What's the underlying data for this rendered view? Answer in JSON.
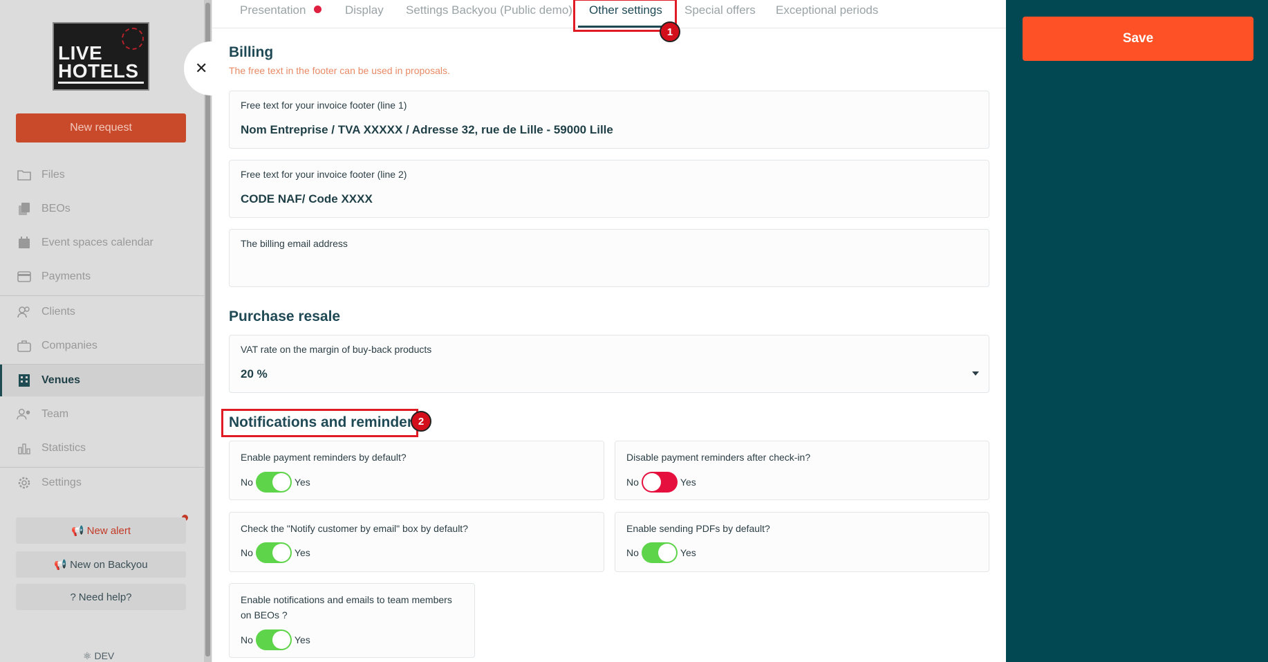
{
  "sidebar": {
    "logo_text": "LIVE HOTELS",
    "new_request": "New request",
    "items": [
      {
        "label": "Files",
        "icon": "folder-icon"
      },
      {
        "label": "BEOs",
        "icon": "copy-icon"
      },
      {
        "label": "Event spaces calendar",
        "icon": "calendar-icon"
      },
      {
        "label": "Payments",
        "icon": "credit-card-icon"
      },
      {
        "label": "Clients",
        "icon": "users-icon"
      },
      {
        "label": "Companies",
        "icon": "briefcase-icon"
      },
      {
        "label": "Venues",
        "icon": "building-icon"
      },
      {
        "label": "Team",
        "icon": "team-icon"
      },
      {
        "label": "Statistics",
        "icon": "bar-chart-icon"
      },
      {
        "label": "Settings",
        "icon": "gear-icon"
      }
    ],
    "active_item": "Venues",
    "new_alert": "New alert",
    "new_on_backyou": "New on Backyou",
    "need_help": "Need help?",
    "env_label": "DEV"
  },
  "tabs": [
    {
      "label": "Presentation"
    },
    {
      "label": "Display"
    },
    {
      "label": "Settings Backyou (Public demo)"
    },
    {
      "label": "Other settings"
    },
    {
      "label": "Special offers"
    },
    {
      "label": "Exceptional periods"
    }
  ],
  "active_tab": "Other settings",
  "annotations": {
    "badge1": "1",
    "badge2": "2"
  },
  "billing": {
    "title": "Billing",
    "subtitle": "The free text in the footer can be used in proposals.",
    "footer1_label": "Free text for your invoice footer (line 1)",
    "footer1_value": "Nom Entreprise / TVA XXXXX / Adresse 32, rue de Lille - 59000 Lille",
    "footer2_label": "Free text for your invoice footer (line 2)",
    "footer2_value": "CODE NAF/ Code XXXX",
    "email_label": "The billing email address",
    "email_value": ""
  },
  "purchase": {
    "title": "Purchase resale",
    "vat_label": "VAT rate on the margin of buy-back products",
    "vat_value": "20 %"
  },
  "notifications": {
    "title": "Notifications and reminders",
    "no": "No",
    "yes": "Yes",
    "items": [
      {
        "question": "Enable payment reminders by default?",
        "on": true
      },
      {
        "question": "Disable payment reminders after check-in?",
        "on": false
      },
      {
        "question": "Check the \"Notify customer by email\" box by default?",
        "on": true
      },
      {
        "question": "Enable sending PDFs by default?",
        "on": true
      },
      {
        "question": "Enable notifications and emails to team members on BEOs ?",
        "on": true
      }
    ]
  },
  "save_label": "Save",
  "colors": {
    "accent": "#ff5126",
    "panel": "#014852",
    "toggle_on": "#5ed44a",
    "toggle_off": "#e5103e",
    "title": "#1f4a55"
  }
}
